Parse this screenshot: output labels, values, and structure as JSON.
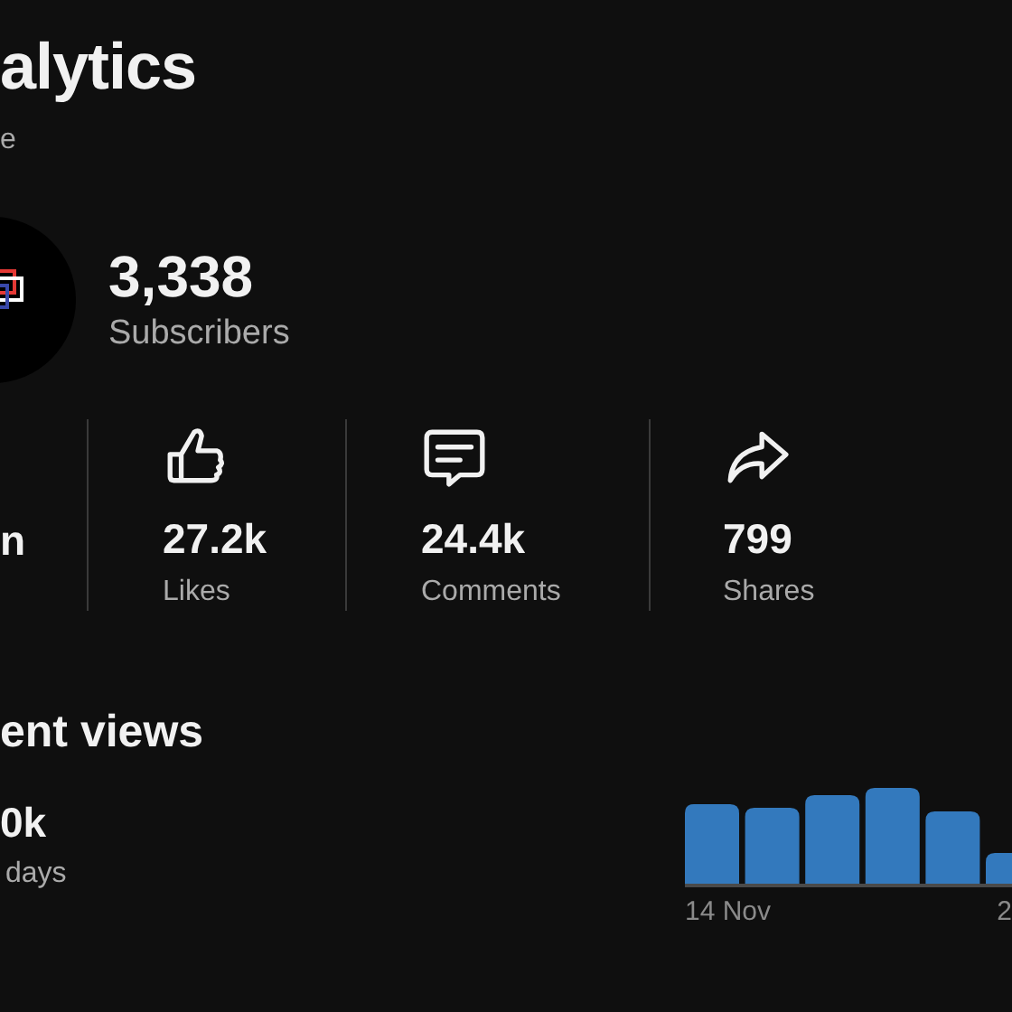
{
  "header": {
    "title": "alytics",
    "subtitle": "e"
  },
  "channel": {
    "subscriber_count": "3,338",
    "subscriber_label": "Subscribers"
  },
  "metrics": [
    {
      "kind": "views",
      "value": "n"
    },
    {
      "kind": "likes",
      "value": "27.2k",
      "label": "Likes"
    },
    {
      "kind": "comments",
      "value": "24.4k",
      "label": "Comments"
    },
    {
      "kind": "shares",
      "value": "799",
      "label": "Shares"
    }
  ],
  "recent_views": {
    "title": "ent views",
    "value": "0k",
    "period": "days",
    "axis_labels": [
      "14 Nov",
      "2"
    ]
  }
}
